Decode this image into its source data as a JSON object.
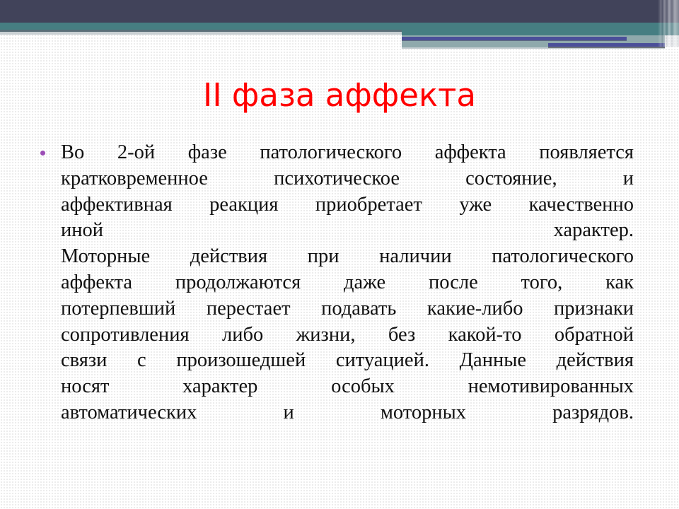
{
  "slide": {
    "title": "II фаза аффекта",
    "colors": {
      "title": "#ff0000",
      "bullet": "#9b4db5",
      "header_dark": "#41435a",
      "header_teal": "#467e82",
      "header_accent_blue": "#4b4f99",
      "header_grey": "#8fa9ac",
      "body_text": "#111111"
    },
    "bullet_icon": "bullet-dot-icon",
    "bullet_lines": [
      "Во 2-ой фазе патологического аффекта появляется",
      "кратковременное психотическое состояние, и",
      "аффективная реакция приобретает уже качественно",
      "иной характер.",
      "Моторные действия при наличии патологического",
      "аффекта продолжаются даже после того, как",
      "потерпевший перестает подавать какие-либо признаки",
      "сопротивления либо жизни, без какой-то обратной",
      "связи с произошедшей ситуацией. Данные действия",
      "носят характер особых немотивированных",
      "автоматических и моторных разрядов."
    ]
  }
}
